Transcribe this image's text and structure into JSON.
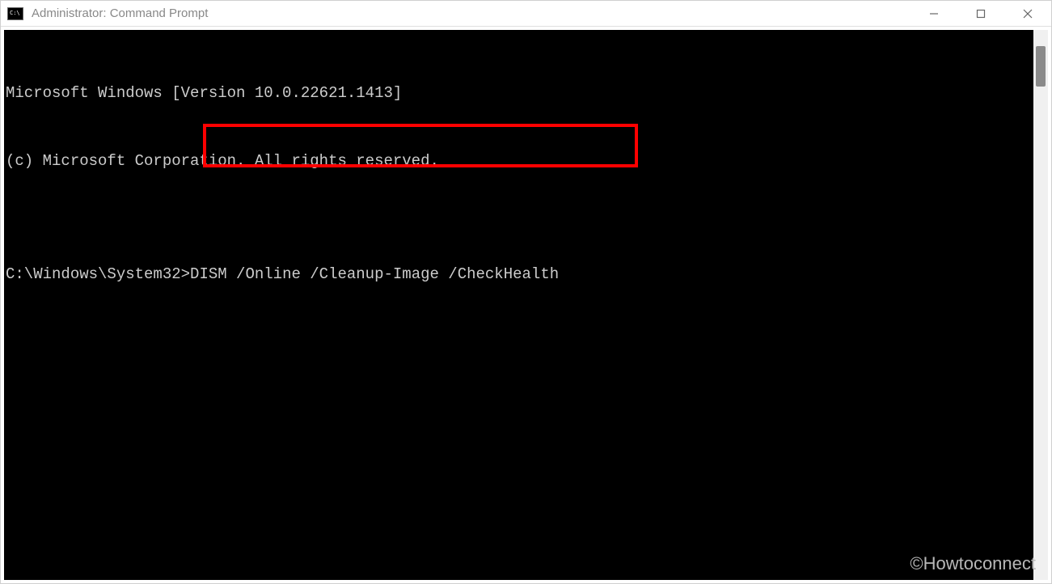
{
  "window": {
    "title": "Administrator: Command Prompt"
  },
  "terminal": {
    "line1": "Microsoft Windows [Version 10.0.22621.1413]",
    "line2": "(c) Microsoft Corporation. All rights reserved.",
    "blank": "",
    "prompt": "C:\\Windows\\System32>",
    "command": "DISM /Online /Cleanup-Image /CheckHealth"
  },
  "watermark": "©Howtoconnect"
}
